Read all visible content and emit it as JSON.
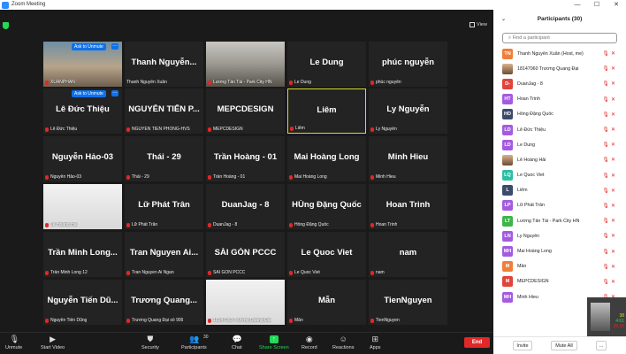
{
  "window": {
    "title": "Zoom Meeting"
  },
  "view_label": "View",
  "tiles": [
    {
      "big": "",
      "small": "XUANPHAN",
      "muted": true,
      "style": "photo",
      "overlay": "Ask to Unmute",
      "col": 0,
      "row": 0
    },
    {
      "big": "Thanh Nguyễn...",
      "small": "Thanh Nguyễn Xuân",
      "muted": false,
      "style": "",
      "overlay": "",
      "col": 1,
      "row": 0
    },
    {
      "big": "",
      "small": "Lương Tấn Tài - Park City HN",
      "muted": true,
      "style": "room",
      "overlay": "",
      "col": 2,
      "row": 0
    },
    {
      "big": "Le Dung",
      "small": "Le Dung",
      "muted": true,
      "style": "",
      "overlay": "",
      "col": 3,
      "row": 0
    },
    {
      "big": "phúc nguyễn",
      "small": "phúc nguyễn",
      "muted": true,
      "style": "",
      "overlay": "",
      "col": 4,
      "row": 0
    },
    {
      "big": "Lê Đức Thiệu",
      "small": "Lê Đức Thiệu",
      "muted": true,
      "style": "",
      "overlay": "Ask to Unmute",
      "col": 0,
      "row": 1
    },
    {
      "big": "NGUYỄN TIẾN P...",
      "small": "NGUYỄN TIẾN PHONG-HVS",
      "muted": true,
      "style": "",
      "overlay": "",
      "col": 1,
      "row": 1
    },
    {
      "big": "MEPCDESIGN",
      "small": "MEPCDESIGN",
      "muted": true,
      "style": "",
      "overlay": "",
      "col": 2,
      "row": 1
    },
    {
      "big": "Liêm",
      "small": "Liêm",
      "muted": true,
      "style": "active",
      "overlay": "",
      "col": 3,
      "row": 1
    },
    {
      "big": "Ly Nguyễn",
      "small": "Ly Nguyễn",
      "muted": true,
      "style": "",
      "overlay": "",
      "col": 4,
      "row": 1
    },
    {
      "big": "Nguyễn Hảo-03",
      "small": "Nguyễn Hảo-03",
      "muted": true,
      "style": "",
      "overlay": "",
      "col": 0,
      "row": 2
    },
    {
      "big": "Thái - 29",
      "small": "Thái - 29",
      "muted": true,
      "style": "",
      "overlay": "",
      "col": 1,
      "row": 2
    },
    {
      "big": "Trần Hoàng - 01",
      "small": "Trần Hoàng - 01",
      "muted": true,
      "style": "",
      "overlay": "",
      "col": 2,
      "row": 2
    },
    {
      "big": "Mai Hoàng Long",
      "small": "Mai Hoàng Long",
      "muted": true,
      "style": "",
      "overlay": "",
      "col": 3,
      "row": 2
    },
    {
      "big": "Minh Hieu",
      "small": "Minh Hieu",
      "muted": true,
      "style": "",
      "overlay": "",
      "col": 4,
      "row": 2
    },
    {
      "big": "",
      "small": "Lê Hoàng Hải",
      "muted": true,
      "style": "face",
      "overlay": "",
      "col": 0,
      "row": 3
    },
    {
      "big": "Lữ Phát Trân",
      "small": "Lữ Phát Trân",
      "muted": true,
      "style": "",
      "overlay": "",
      "col": 1,
      "row": 3
    },
    {
      "big": "DuanJag - 8",
      "small": "DuanJag - 8",
      "muted": true,
      "style": "",
      "overlay": "",
      "col": 2,
      "row": 3
    },
    {
      "big": "HÙng Đặng Quốc",
      "small": "Hồng Đặng Quốc",
      "muted": true,
      "style": "",
      "overlay": "",
      "col": 3,
      "row": 3
    },
    {
      "big": "Hoan Trinh",
      "small": "Hoan Trinh",
      "muted": true,
      "style": "",
      "overlay": "",
      "col": 4,
      "row": 3
    },
    {
      "big": "Trần Minh Long...",
      "small": "Trần Minh Long 12",
      "muted": true,
      "style": "",
      "overlay": "",
      "col": 0,
      "row": 4
    },
    {
      "big": "Tran Nguyen Ai...",
      "small": "Tran Nguyen Ai Ngan",
      "muted": true,
      "style": "",
      "overlay": "",
      "col": 1,
      "row": 4
    },
    {
      "big": "SÀI GÒN PCCC",
      "small": "SÀI GÒN PCCC",
      "muted": true,
      "style": "",
      "overlay": "",
      "col": 2,
      "row": 4
    },
    {
      "big": "Le Quoc Viet",
      "small": "Le Quoc Viet",
      "muted": true,
      "style": "",
      "overlay": "",
      "col": 3,
      "row": 4
    },
    {
      "big": "nam",
      "small": "nam",
      "muted": true,
      "style": "",
      "overlay": "",
      "col": 4,
      "row": 4
    },
    {
      "big": "Nguyễn Tiến Dũ...",
      "small": "Nguyễn Tiến Dũng",
      "muted": true,
      "style": "",
      "overlay": "",
      "col": 0,
      "row": 5
    },
    {
      "big": "Trương Quang...",
      "small": "Trương Quang Đại số 999",
      "muted": true,
      "style": "",
      "overlay": "",
      "col": 1,
      "row": 5
    },
    {
      "big": "",
      "small": "18147060 Trương Quang Đại",
      "muted": true,
      "style": "face",
      "overlay": "",
      "col": 2,
      "row": 5
    },
    {
      "big": "Mẫn",
      "small": "Mẫn",
      "muted": true,
      "style": "",
      "overlay": "",
      "col": 3,
      "row": 5
    },
    {
      "big": "TienNguyen",
      "small": "TienNguyen",
      "muted": true,
      "style": "",
      "overlay": "",
      "col": 4,
      "row": 5
    }
  ],
  "toolbar": {
    "unmute": "Unmute",
    "start_video": "Start Video",
    "security": "Security",
    "participants": "Participants",
    "participants_count": "30",
    "chat": "Chat",
    "share_screen": "Share Screen",
    "record": "Record",
    "reactions": "Reactions",
    "apps": "Apps",
    "end": "End"
  },
  "panel": {
    "title": "Participants (30)",
    "search_placeholder": "Find a participant",
    "invite": "Invite",
    "mute_all": "Mute All",
    "more": "...",
    "participants": [
      {
        "initials": "TN",
        "color": "#f07e3a",
        "name": "Thanh Nguyễn Xuân (Host, me)",
        "img": false
      },
      {
        "initials": "",
        "color": "#888888",
        "name": "18147060 Trương Quang Đại",
        "img": true
      },
      {
        "initials": "D-",
        "color": "#e0443a",
        "name": "DuanJag - 8",
        "img": false
      },
      {
        "initials": "HT",
        "color": "#a45be0",
        "name": "Hoan Trinh",
        "img": false
      },
      {
        "initials": "HD",
        "color": "#3b4b6b",
        "name": "Hồng Đặng Quốc",
        "img": false
      },
      {
        "initials": "LD",
        "color": "#a45be0",
        "name": "Lê Đức Thiệu",
        "img": false
      },
      {
        "initials": "LD",
        "color": "#a45be0",
        "name": "Le Dung",
        "img": false
      },
      {
        "initials": "",
        "color": "#888888",
        "name": "Lê Hoàng Hải",
        "img": true
      },
      {
        "initials": "LQ",
        "color": "#2bbfa4",
        "name": "Le Quoc Viet",
        "img": false
      },
      {
        "initials": "L",
        "color": "#3b4b6b",
        "name": "Liêm",
        "img": false
      },
      {
        "initials": "LP",
        "color": "#a45be0",
        "name": "Lữ Phát Trân",
        "img": false
      },
      {
        "initials": "LT",
        "color": "#3db54a",
        "name": "Lương Tấn Tài - Park City HN",
        "img": false
      },
      {
        "initials": "LN",
        "color": "#a45be0",
        "name": "Ly Nguyễn",
        "img": false
      },
      {
        "initials": "MH",
        "color": "#a45be0",
        "name": "Mai Hoàng Long",
        "img": false
      },
      {
        "initials": "M",
        "color": "#f07e3a",
        "name": "Mẫn",
        "img": false
      },
      {
        "initials": "M",
        "color": "#e0443a",
        "name": "MEPCDESIGN",
        "img": false
      },
      {
        "initials": "MH",
        "color": "#a45be0",
        "name": "Minh Hieu",
        "img": false
      }
    ]
  },
  "overlay_thumb": {
    "n1": "38",
    "n2": "4:61",
    "n3": "29.15"
  }
}
